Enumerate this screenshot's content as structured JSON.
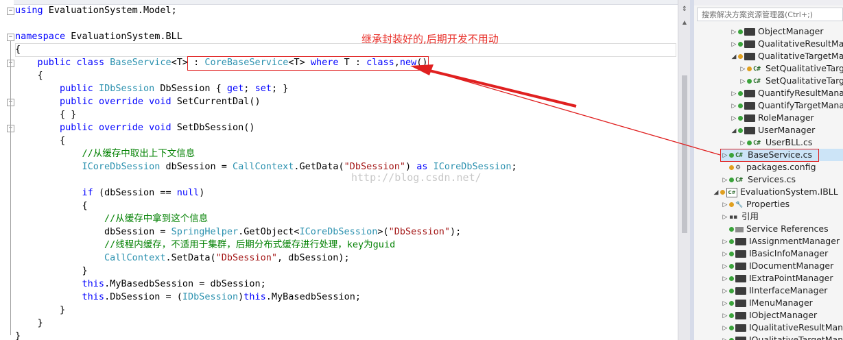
{
  "annotation": "继承封装好的,后期开发不用动",
  "watermark": "http://blog.csdn.net/",
  "code": [
    {
      "tokens": [
        [
          "kw",
          "using"
        ],
        [
          "plain",
          " EvaluationSystem.Model;"
        ]
      ]
    },
    {
      "tokens": []
    },
    {
      "tokens": [
        [
          "kw",
          "namespace"
        ],
        [
          "plain",
          " EvaluationSystem.BLL"
        ]
      ]
    },
    {
      "tokens": [
        [
          "plain",
          "{"
        ]
      ]
    },
    {
      "tokens": [
        [
          "plain",
          "    "
        ],
        [
          "kw",
          "public"
        ],
        [
          "plain",
          " "
        ],
        [
          "kw",
          "class"
        ],
        [
          "plain",
          " "
        ],
        [
          "ty",
          "BaseService"
        ],
        [
          "plain",
          "<T>"
        ],
        [
          "plain",
          " : "
        ],
        [
          "ty",
          "CoreBaseService"
        ],
        [
          "plain",
          "<T> "
        ],
        [
          "kw",
          "where"
        ],
        [
          "plain",
          " T : "
        ],
        [
          "kw",
          "class"
        ],
        [
          "plain",
          ","
        ],
        [
          "kw",
          "new"
        ],
        [
          "plain",
          "()"
        ]
      ]
    },
    {
      "tokens": [
        [
          "plain",
          "    {"
        ]
      ]
    },
    {
      "tokens": [
        [
          "plain",
          "        "
        ],
        [
          "kw",
          "public"
        ],
        [
          "plain",
          " "
        ],
        [
          "ty",
          "IDbSession"
        ],
        [
          "plain",
          " DbSession { "
        ],
        [
          "kw",
          "get"
        ],
        [
          "plain",
          "; "
        ],
        [
          "kw",
          "set"
        ],
        [
          "plain",
          "; }"
        ]
      ]
    },
    {
      "tokens": [
        [
          "plain",
          "        "
        ],
        [
          "kw",
          "public"
        ],
        [
          "plain",
          " "
        ],
        [
          "kw",
          "override"
        ],
        [
          "plain",
          " "
        ],
        [
          "kw",
          "void"
        ],
        [
          "plain",
          " SetCurrentDal()"
        ]
      ]
    },
    {
      "tokens": [
        [
          "plain",
          "        { }"
        ]
      ]
    },
    {
      "tokens": [
        [
          "plain",
          "        "
        ],
        [
          "kw",
          "public"
        ],
        [
          "plain",
          " "
        ],
        [
          "kw",
          "override"
        ],
        [
          "plain",
          " "
        ],
        [
          "kw",
          "void"
        ],
        [
          "plain",
          " SetDbSession()"
        ]
      ]
    },
    {
      "tokens": [
        [
          "plain",
          "        {"
        ]
      ]
    },
    {
      "tokens": [
        [
          "plain",
          "            "
        ],
        [
          "cm",
          "//从缓存中取出上下文信息"
        ]
      ]
    },
    {
      "tokens": [
        [
          "plain",
          "            "
        ],
        [
          "ty",
          "ICoreDbSession"
        ],
        [
          "plain",
          " dbSession = "
        ],
        [
          "ty",
          "CallContext"
        ],
        [
          "plain",
          ".GetData("
        ],
        [
          "str",
          "\"DbSession\""
        ],
        [
          "plain",
          ") "
        ],
        [
          "kw",
          "as"
        ],
        [
          "plain",
          " "
        ],
        [
          "ty",
          "ICoreDbSession"
        ],
        [
          "plain",
          ";"
        ]
      ]
    },
    {
      "tokens": []
    },
    {
      "tokens": [
        [
          "plain",
          "            "
        ],
        [
          "kw",
          "if"
        ],
        [
          "plain",
          " (dbSession == "
        ],
        [
          "kw",
          "null"
        ],
        [
          "plain",
          ")"
        ]
      ]
    },
    {
      "tokens": [
        [
          "plain",
          "            {"
        ]
      ]
    },
    {
      "tokens": [
        [
          "plain",
          "                "
        ],
        [
          "cm",
          "//从缓存中拿到这个信息"
        ]
      ]
    },
    {
      "tokens": [
        [
          "plain",
          "                dbSession = "
        ],
        [
          "ty",
          "SpringHelper"
        ],
        [
          "plain",
          ".GetObject<"
        ],
        [
          "ty",
          "ICoreDbSession"
        ],
        [
          "plain",
          ">("
        ],
        [
          "str",
          "\"DbSession\""
        ],
        [
          "plain",
          ");"
        ]
      ]
    },
    {
      "tokens": [
        [
          "plain",
          "                "
        ],
        [
          "cm",
          "//线程内缓存，不适用于集群，后期分布式缓存进行处理，key为guid"
        ]
      ]
    },
    {
      "tokens": [
        [
          "plain",
          "                "
        ],
        [
          "ty",
          "CallContext"
        ],
        [
          "plain",
          ".SetData("
        ],
        [
          "str",
          "\"DbSession\""
        ],
        [
          "plain",
          ", dbSession);"
        ]
      ]
    },
    {
      "tokens": [
        [
          "plain",
          "            }"
        ]
      ]
    },
    {
      "tokens": [
        [
          "plain",
          "            "
        ],
        [
          "kw",
          "this"
        ],
        [
          "plain",
          ".MyBasedbSession = dbSession;"
        ]
      ]
    },
    {
      "tokens": [
        [
          "plain",
          "            "
        ],
        [
          "kw",
          "this"
        ],
        [
          "plain",
          ".DbSession = ("
        ],
        [
          "ty",
          "IDbSession"
        ],
        [
          "plain",
          ")"
        ],
        [
          "kw",
          "this"
        ],
        [
          "plain",
          ".MyBasedbSession;"
        ]
      ]
    },
    {
      "tokens": [
        [
          "plain",
          "        }"
        ]
      ]
    },
    {
      "tokens": [
        [
          "plain",
          "    }"
        ]
      ]
    },
    {
      "tokens": [
        [
          "plain",
          "}"
        ]
      ]
    }
  ],
  "explorer": {
    "search_placeholder": "搜索解决方案资源管理器(Ctrl+;)",
    "items": [
      {
        "label": "ObjectManager",
        "icon": "folder-icon",
        "indent": 4,
        "expander": "▷"
      },
      {
        "label": "QualitativeResultManager",
        "icon": "folder-icon",
        "indent": 4,
        "expander": "▷"
      },
      {
        "label": "QualitativeTargetManager",
        "icon": "folder-icon",
        "indent": 4,
        "expander": "◢",
        "dot": "amber"
      },
      {
        "label": "SetQualitativeTarget",
        "icon": "cs-file-icon",
        "indent": 5,
        "expander": "▷",
        "dot": "amber"
      },
      {
        "label": "SetQualitativeTarget",
        "icon": "cs-file-icon",
        "indent": 5,
        "expander": "▷"
      },
      {
        "label": "QuantifyResultManager",
        "icon": "folder-icon",
        "indent": 4,
        "expander": "▷"
      },
      {
        "label": "QuantifyTargetManager",
        "icon": "folder-icon",
        "indent": 4,
        "expander": "▷"
      },
      {
        "label": "RoleManager",
        "icon": "folder-icon",
        "indent": 4,
        "expander": "▷"
      },
      {
        "label": "UserManager",
        "icon": "folder-icon",
        "indent": 4,
        "expander": "◢"
      },
      {
        "label": "UserBLL.cs",
        "icon": "cs-file-icon",
        "indent": 5,
        "expander": "▷"
      },
      {
        "label": "BaseService.cs",
        "icon": "cs-file-icon",
        "indent": 3,
        "expander": "▷",
        "selected": true
      },
      {
        "label": "packages.config",
        "icon": "config-icon",
        "indent": 3,
        "expander": "",
        "dot": "amber"
      },
      {
        "label": "Services.cs",
        "icon": "cs-file-icon",
        "indent": 3,
        "expander": "▷"
      },
      {
        "label": "EvaluationSystem.IBLL",
        "icon": "project-icon",
        "indent": 2,
        "expander": "◢",
        "dot": "amber"
      },
      {
        "label": "Properties",
        "icon": "wrench-icon",
        "indent": 3,
        "expander": "▷",
        "dot": "amber"
      },
      {
        "label": "引用",
        "icon": "reference-icon",
        "indent": 3,
        "expander": "▷",
        "nodot": true
      },
      {
        "label": "Service References",
        "icon": "service-icon",
        "indent": 3,
        "expander": ""
      },
      {
        "label": "IAssignmentManager",
        "icon": "folder-icon",
        "indent": 3,
        "expander": "▷"
      },
      {
        "label": "IBasicInfoManager",
        "icon": "folder-icon",
        "indent": 3,
        "expander": "▷"
      },
      {
        "label": "IDocumentManager",
        "icon": "folder-icon",
        "indent": 3,
        "expander": "▷"
      },
      {
        "label": "IExtraPointManager",
        "icon": "folder-icon",
        "indent": 3,
        "expander": "▷"
      },
      {
        "label": "IInterfaceManager",
        "icon": "folder-icon",
        "indent": 3,
        "expander": "▷"
      },
      {
        "label": "IMenuManager",
        "icon": "folder-icon",
        "indent": 3,
        "expander": "▷"
      },
      {
        "label": "IObjectManager",
        "icon": "folder-icon",
        "indent": 3,
        "expander": "▷"
      },
      {
        "label": "IQualitativeResultManager",
        "icon": "folder-icon",
        "indent": 3,
        "expander": "▷"
      },
      {
        "label": "IQualitativeTargetManager",
        "icon": "folder-icon",
        "indent": 3,
        "expander": "▷"
      }
    ]
  },
  "colors": {
    "keyword": "#0000ff",
    "type": "#2b91af",
    "string": "#a31515",
    "comment": "#008000",
    "annotation": "#e8302a"
  }
}
